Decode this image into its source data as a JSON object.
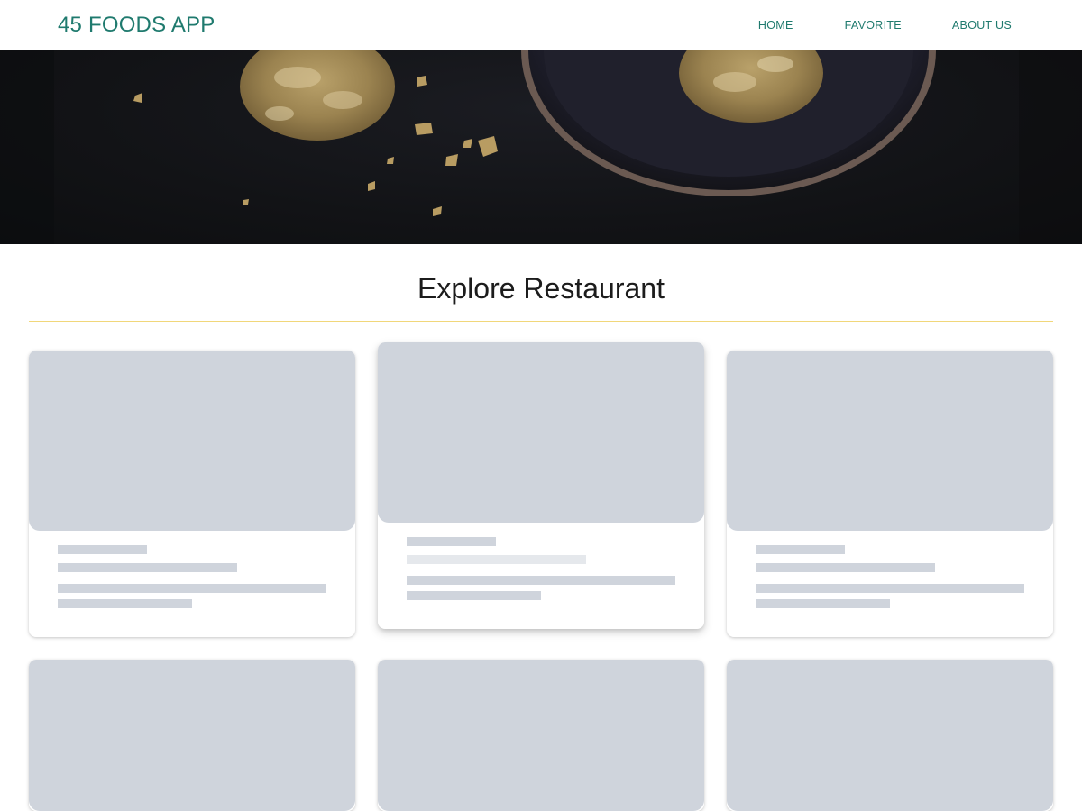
{
  "header": {
    "brand": "45 FOODS APP",
    "nav": [
      "HOME",
      "FAVORITE",
      "ABOUT US"
    ]
  },
  "hero": {
    "image": "cookies-on-dark-table"
  },
  "main": {
    "title": "Explore Restaurant",
    "cards_state": "loading-skeleton",
    "card_count": 6
  },
  "colors": {
    "accent": "#1f7a6e",
    "divider": "#f1d77a",
    "skeleton": "#cfd4dc",
    "skeleton_light": "#e5e8ec"
  },
  "icons": [
    "cookie-image"
  ]
}
